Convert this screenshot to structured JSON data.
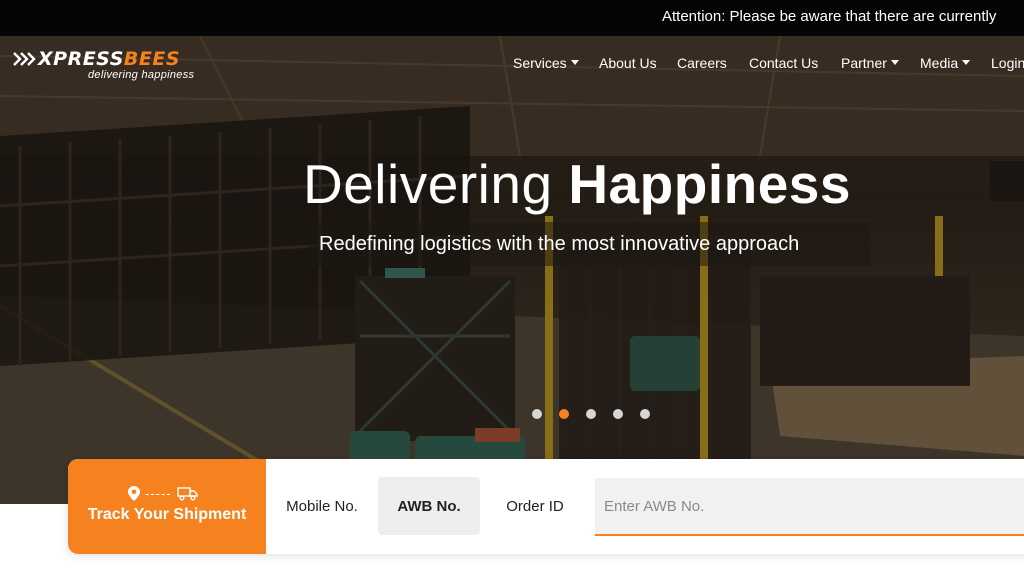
{
  "announcement": "Attention: Please be aware that there are currently",
  "logo": {
    "brand_main": "XPRESS",
    "brand_accent": "BEES",
    "tagline": "delivering happiness"
  },
  "nav": {
    "services": "Services",
    "about": "About Us",
    "careers": "Careers",
    "contact": "Contact Us",
    "partner": "Partner",
    "media": "Media",
    "login": "Login"
  },
  "hero": {
    "headline_light": "Delivering ",
    "headline_bold": "Happiness",
    "subheadline": "Redefining logistics with the most innovative approach",
    "slides": 5,
    "active_slide": 2
  },
  "tracking": {
    "title": "Track Your Shipment",
    "dashes": "-----",
    "tab_mobile": "Mobile No.",
    "tab_awb": "AWB No.",
    "tab_order": "Order ID",
    "active_tab": "AWB No.",
    "input_placeholder": "Enter AWB No.",
    "input_value": ""
  },
  "colors": {
    "accent": "#f5821f",
    "topbar": "#050505",
    "white": "#ffffff"
  },
  "icons": [
    "location-pin-icon",
    "delivery-truck-icon",
    "chevron-down-icon",
    "logo-chevrons-icon"
  ]
}
